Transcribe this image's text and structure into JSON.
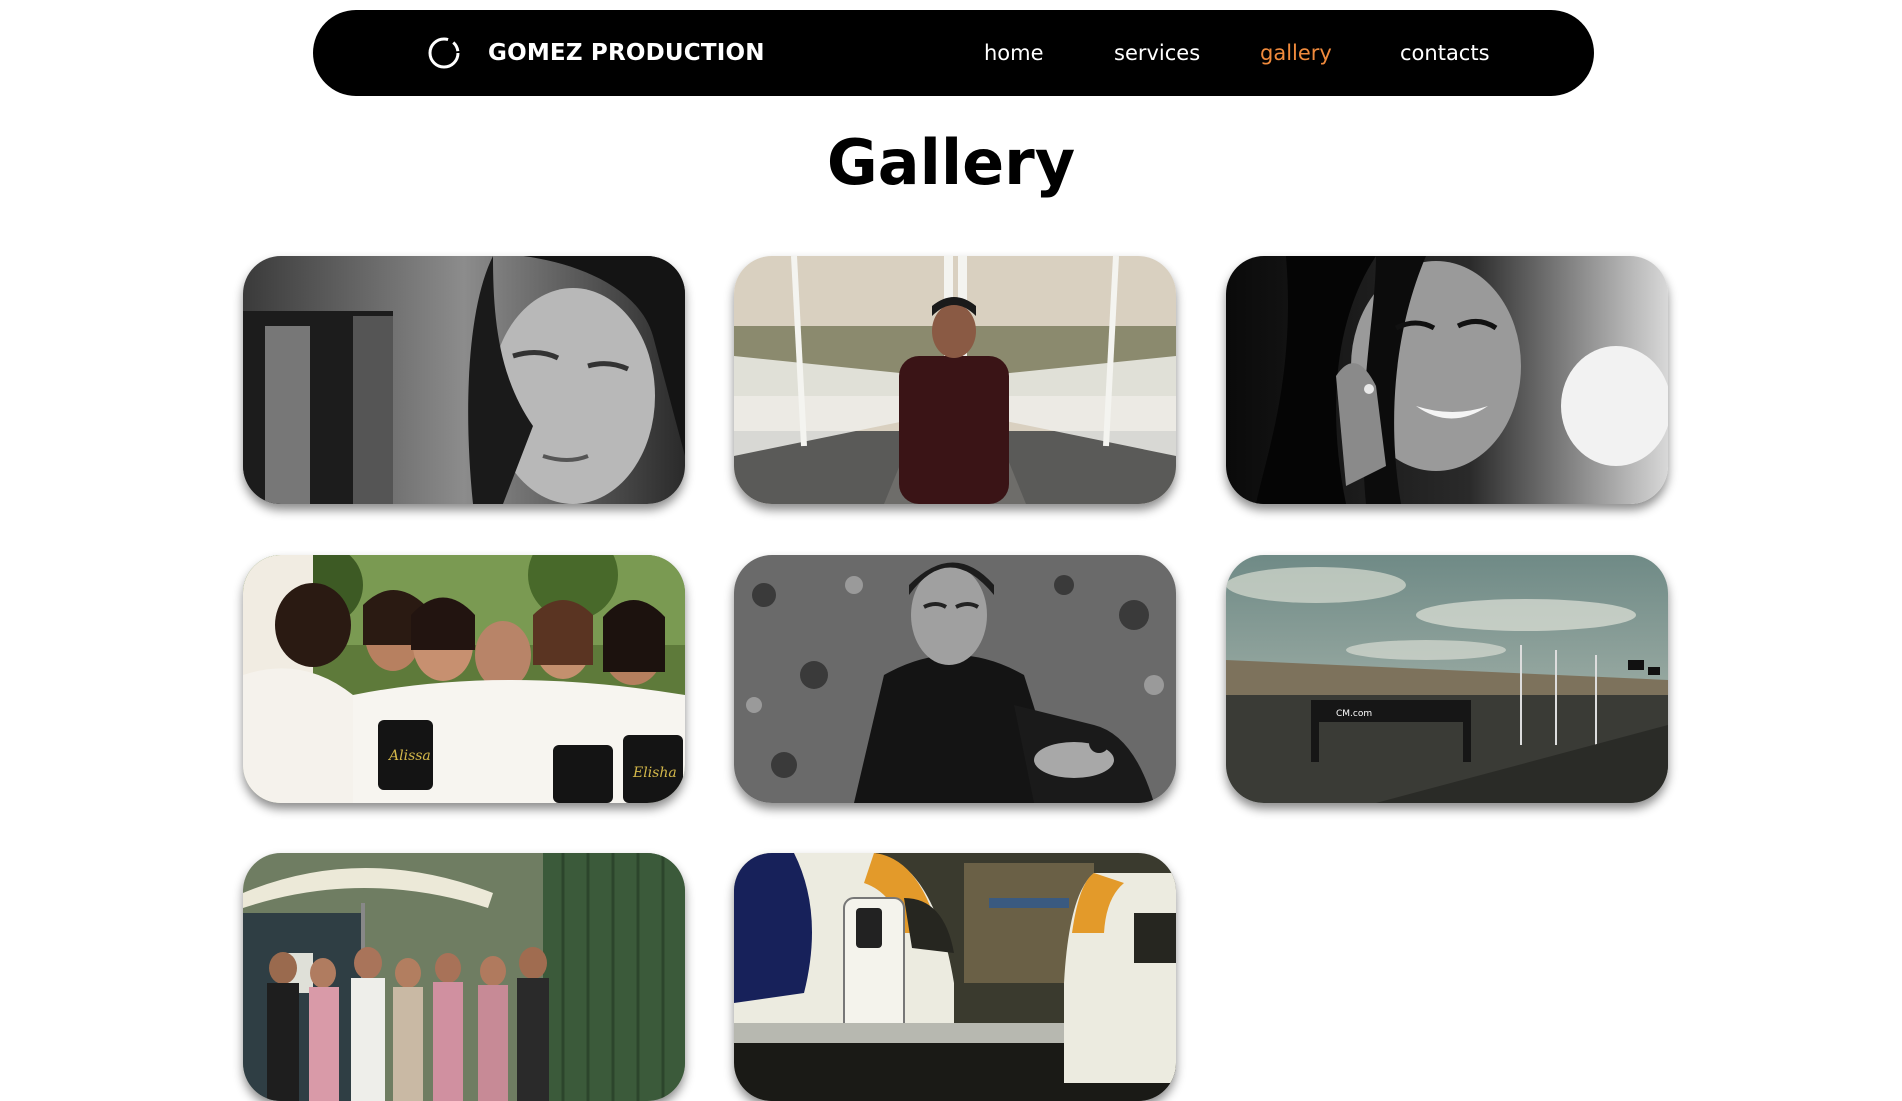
{
  "header": {
    "brand": "GOMEZ PRODUCTION",
    "logo_icon": "circle-logo-icon",
    "nav": [
      {
        "label": "home",
        "active": false
      },
      {
        "label": "services",
        "active": false
      },
      {
        "label": "gallery",
        "active": true
      },
      {
        "label": "contacts",
        "active": false
      }
    ]
  },
  "page": {
    "title": "Gallery"
  },
  "colors": {
    "navbar": "#000000",
    "accent": "#f08a3c",
    "text_on_dark": "#ffffff"
  }
}
